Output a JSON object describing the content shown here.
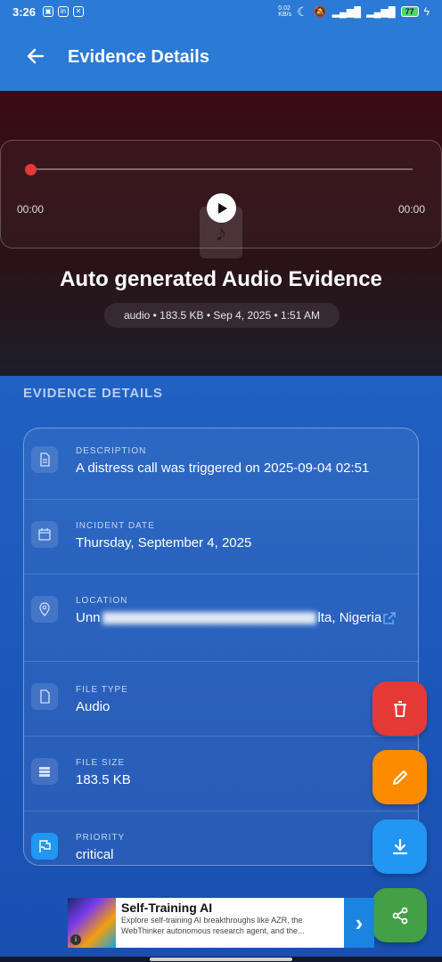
{
  "status_bar": {
    "time": "3:26",
    "net_speed": "0.02\nKB/s",
    "battery": "77"
  },
  "app_bar": {
    "title": "Evidence Details"
  },
  "player": {
    "current_time": "00:00",
    "total_time": "00:00",
    "progress": 0
  },
  "evidence": {
    "title": "Auto generated Audio Evidence",
    "meta": "audio • 183.5 KB • Sep 4, 2025 • 1:51 AM"
  },
  "section": {
    "heading": "EVIDENCE DETAILS"
  },
  "details": {
    "description_label": "DESCRIPTION",
    "description_value": "A distress call was triggered on 2025-09-04 02:51",
    "incident_label": "INCIDENT DATE",
    "incident_value": "Thursday, September 4, 2025",
    "location_label": "LOCATION",
    "location_start": "Unn",
    "location_end": "lta, Nigeria",
    "filetype_label": "FILE TYPE",
    "filetype_value": "Audio",
    "filesize_label": "FILE SIZE",
    "filesize_value": "183.5 KB",
    "priority_label": "PRIORITY",
    "priority_value": "critical"
  },
  "fabs": {
    "delete_color": "#e53935",
    "edit_color": "#fb8c00",
    "download_color": "#2196f3",
    "share_color": "#43a047"
  },
  "ad": {
    "title": "Self-Training AI",
    "body": "Explore self-training AI breakthroughs like AZR, the WebThinker autonomous research agent, and the..."
  }
}
